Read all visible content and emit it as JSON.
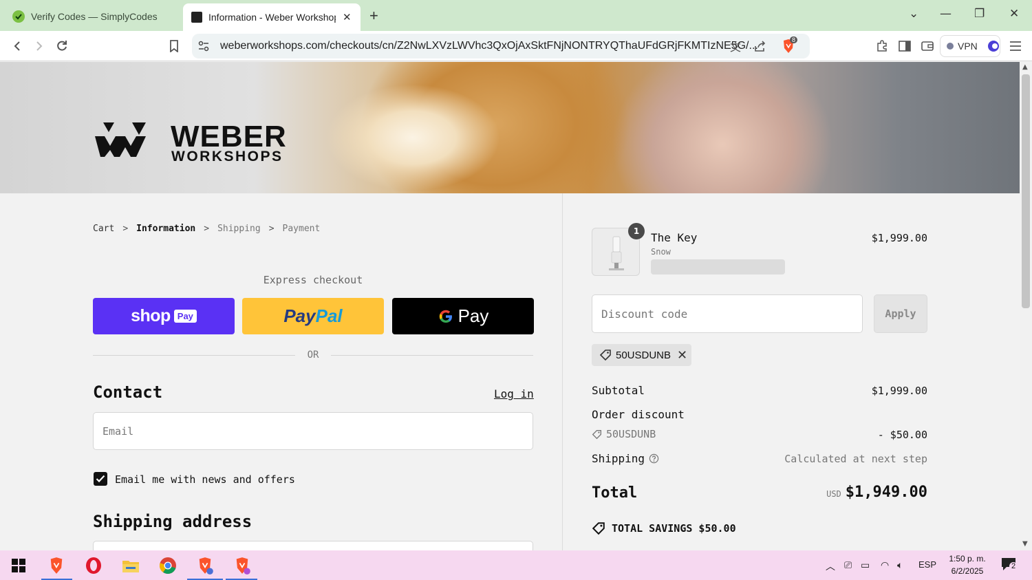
{
  "browser": {
    "tabs": [
      {
        "title": "Verify Codes — SimplyCodes",
        "active": false
      },
      {
        "title": "Information - Weber Workshops",
        "active": true
      }
    ],
    "url": "weberworkshops.com/checkouts/cn/Z2NwLXVzLWVhc3QxOjAxSktFNjNONTRYQThaUFdGRjFKMTIzNE5G/...",
    "vpn_label": "VPN",
    "brave_badge": "8"
  },
  "hero": {
    "brand_line1": "WEBER",
    "brand_line2": "WORKSHOPS"
  },
  "breadcrumb": {
    "items": [
      "Cart",
      "Information",
      "Shipping",
      "Payment"
    ],
    "separator": ">"
  },
  "express": {
    "heading": "Express checkout",
    "shop_word": "shop",
    "shop_pay": "Pay",
    "paypal_a": "Pay",
    "paypal_b": "Pal",
    "gpay_g": "G",
    "gpay_pay": "Pay",
    "or_text": "OR"
  },
  "contact": {
    "heading": "Contact",
    "login_label": "Log in",
    "email_placeholder": "Email",
    "newsletter_label": "Email me with news and offers",
    "newsletter_checked": true
  },
  "shipping_address": {
    "heading": "Shipping address"
  },
  "summary": {
    "item": {
      "name": "The Key",
      "variant": "Snow",
      "price": "$1,999.00",
      "quantity": "1"
    },
    "discount_placeholder": "Discount code",
    "apply_label": "Apply",
    "applied_code": "50USDUNB",
    "subtotal_label": "Subtotal",
    "subtotal_value": "$1,999.00",
    "order_discount_label": "Order discount",
    "discount_code": "50USDUNB",
    "discount_value": "- $50.00",
    "shipping_label": "Shipping",
    "shipping_value": "Calculated at next step",
    "total_label": "Total",
    "total_currency": "USD",
    "total_value": "$1,949.00",
    "savings_text": "TOTAL SAVINGS $50.00"
  },
  "taskbar": {
    "lang": "ESP",
    "time": "1:50 p. m.",
    "date": "6/2/2025",
    "notifications": "2"
  },
  "colors": {
    "tabbar_bg": "#cfe8cd",
    "shop_purple": "#5a31f4",
    "paypal_yellow": "#ffc439",
    "taskbar_bg": "#f6d8f0"
  }
}
